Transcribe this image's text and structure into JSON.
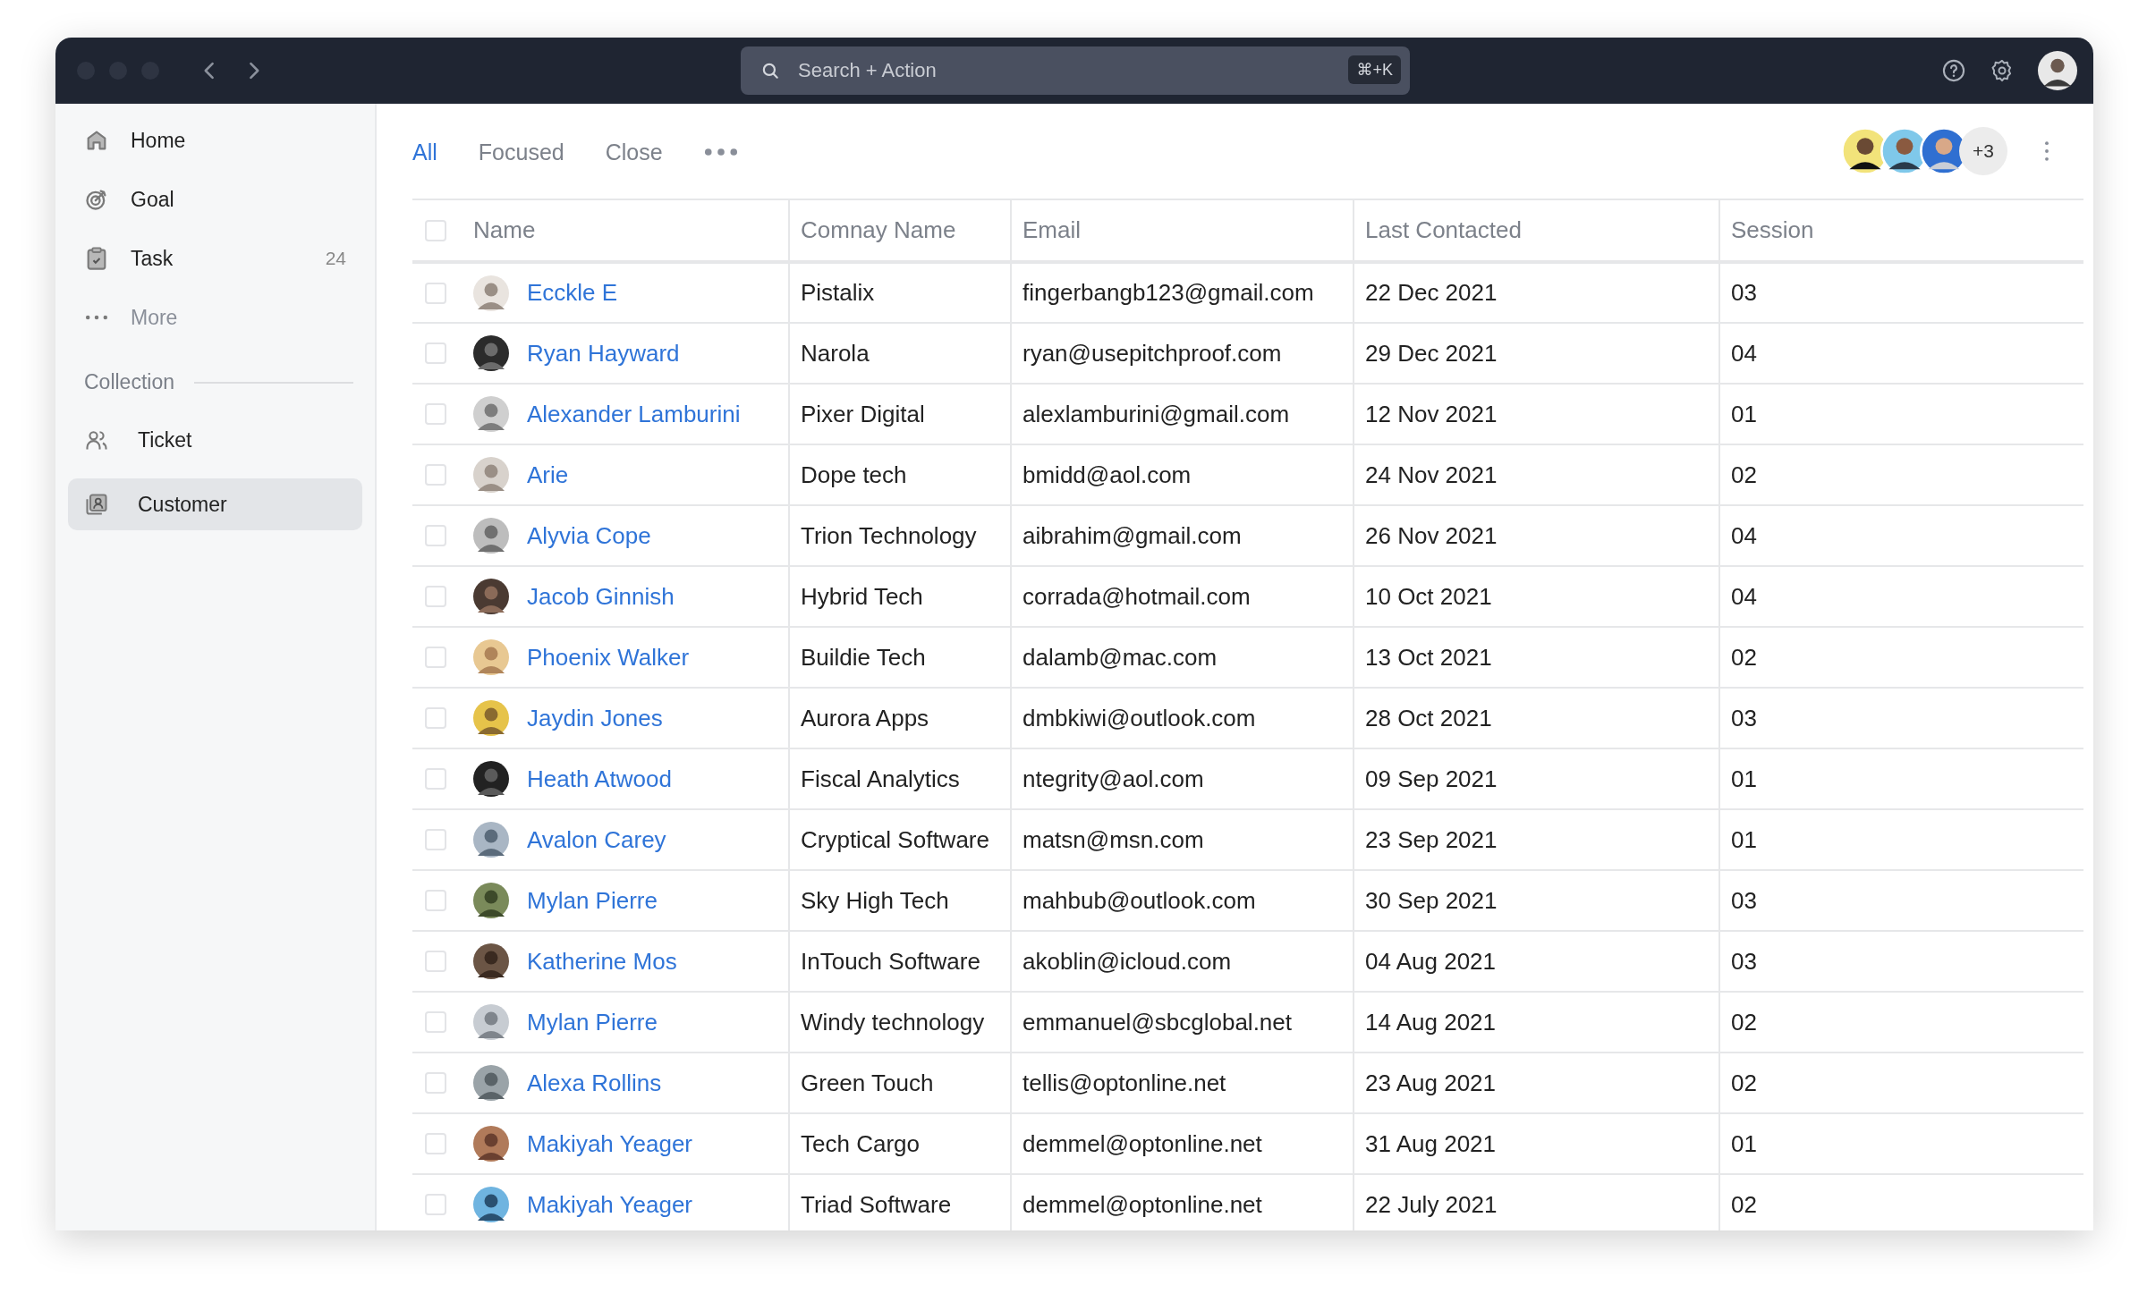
{
  "titlebar": {
    "search": {
      "placeholder": "Search + Action",
      "shortcut": "⌘+K"
    }
  },
  "sidebar": {
    "items": [
      {
        "label": "Home",
        "kind": "home",
        "selected": false
      },
      {
        "label": "Goal",
        "kind": "goal",
        "selected": false
      },
      {
        "label": "Task",
        "kind": "task",
        "count": "24",
        "selected": false
      },
      {
        "label": "More",
        "kind": "more",
        "selected": false
      }
    ],
    "section": "Collection",
    "collection_items": [
      {
        "label": "Ticket",
        "kind": "people",
        "selected": false
      },
      {
        "label": "Customer",
        "kind": "contact",
        "selected": true
      }
    ]
  },
  "tabs": [
    {
      "label": "All",
      "selected": true
    },
    {
      "label": "Focused",
      "selected": false
    },
    {
      "label": "Close",
      "selected": false
    }
  ],
  "collaborators": {
    "extra": "+3"
  },
  "table": {
    "select_all_checked": false,
    "columns": [
      "Name",
      "Comnay Name",
      "Email",
      "Last Contacted",
      "Session"
    ],
    "rows": [
      {
        "checked": false,
        "name": "Ecckle E",
        "company": "Pistalix",
        "email": "fingerbangb123@gmail.com",
        "last_contacted": "22 Dec 2021",
        "session": "03"
      },
      {
        "checked": false,
        "name": "Ryan Hayward",
        "company": "Narola",
        "email": "ryan@usepitchproof.com",
        "last_contacted": "29 Dec 2021",
        "session": "04"
      },
      {
        "checked": false,
        "name": "Alexander Lamburini",
        "company": "Pixer Digital",
        "email": "alexlamburini@gmail.com",
        "last_contacted": "12 Nov 2021",
        "session": "01"
      },
      {
        "checked": false,
        "name": "Arie",
        "company": "Dope tech",
        "email": "bmidd@aol.com",
        "last_contacted": "24 Nov 2021",
        "session": "02"
      },
      {
        "checked": false,
        "name": "Alyvia Cope",
        "company": "Trion Technology",
        "email": "aibrahim@gmail.com",
        "last_contacted": "26 Nov 2021",
        "session": "04"
      },
      {
        "checked": false,
        "name": "Jacob Ginnish",
        "company": "Hybrid Tech",
        "email": "corrada@hotmail.com",
        "last_contacted": "10 Oct 2021",
        "session": "04"
      },
      {
        "checked": false,
        "name": "Phoenix Walker",
        "company": "Buildie Tech",
        "email": "dalamb@mac.com",
        "last_contacted": "13 Oct 2021",
        "session": "02"
      },
      {
        "checked": false,
        "name": "Jaydin Jones",
        "company": "Aurora Apps",
        "email": "dmbkiwi@outlook.com",
        "last_contacted": "28 Oct 2021",
        "session": "03"
      },
      {
        "checked": false,
        "name": "Heath Atwood",
        "company": "Fiscal Analytics",
        "email": "ntegrity@aol.com",
        "last_contacted": "09 Sep 2021",
        "session": "01"
      },
      {
        "checked": false,
        "name": "Avalon Carey",
        "company": "Cryptical Software",
        "email": "matsn@msn.com",
        "last_contacted": "23 Sep 2021",
        "session": "01"
      },
      {
        "checked": false,
        "name": "Mylan Pierre",
        "company": "Sky High Tech",
        "email": "mahbub@outlook.com",
        "last_contacted": "30 Sep 2021",
        "session": "03"
      },
      {
        "checked": false,
        "name": "Katherine Mos",
        "company": "InTouch Software",
        "email": "akoblin@icloud.com",
        "last_contacted": "04 Aug 2021",
        "session": "03"
      },
      {
        "checked": false,
        "name": "Mylan Pierre",
        "company": "Windy technology",
        "email": "emmanuel@sbcglobal.net",
        "last_contacted": "14 Aug 2021",
        "session": "02"
      },
      {
        "checked": false,
        "name": "Alexa Rollins",
        "company": "Green Touch",
        "email": "tellis@optonline.net",
        "last_contacted": "23 Aug 2021",
        "session": "02"
      },
      {
        "checked": false,
        "name": "Makiyah Yeager",
        "company": "Tech Cargo",
        "email": "demmel@optonline.net",
        "last_contacted": "31 Aug 2021",
        "session": "01"
      },
      {
        "checked": false,
        "name": "Makiyah Yeager",
        "company": "Triad Software",
        "email": "demmel@optonline.net",
        "last_contacted": "22 July 2021",
        "session": "02"
      }
    ]
  }
}
